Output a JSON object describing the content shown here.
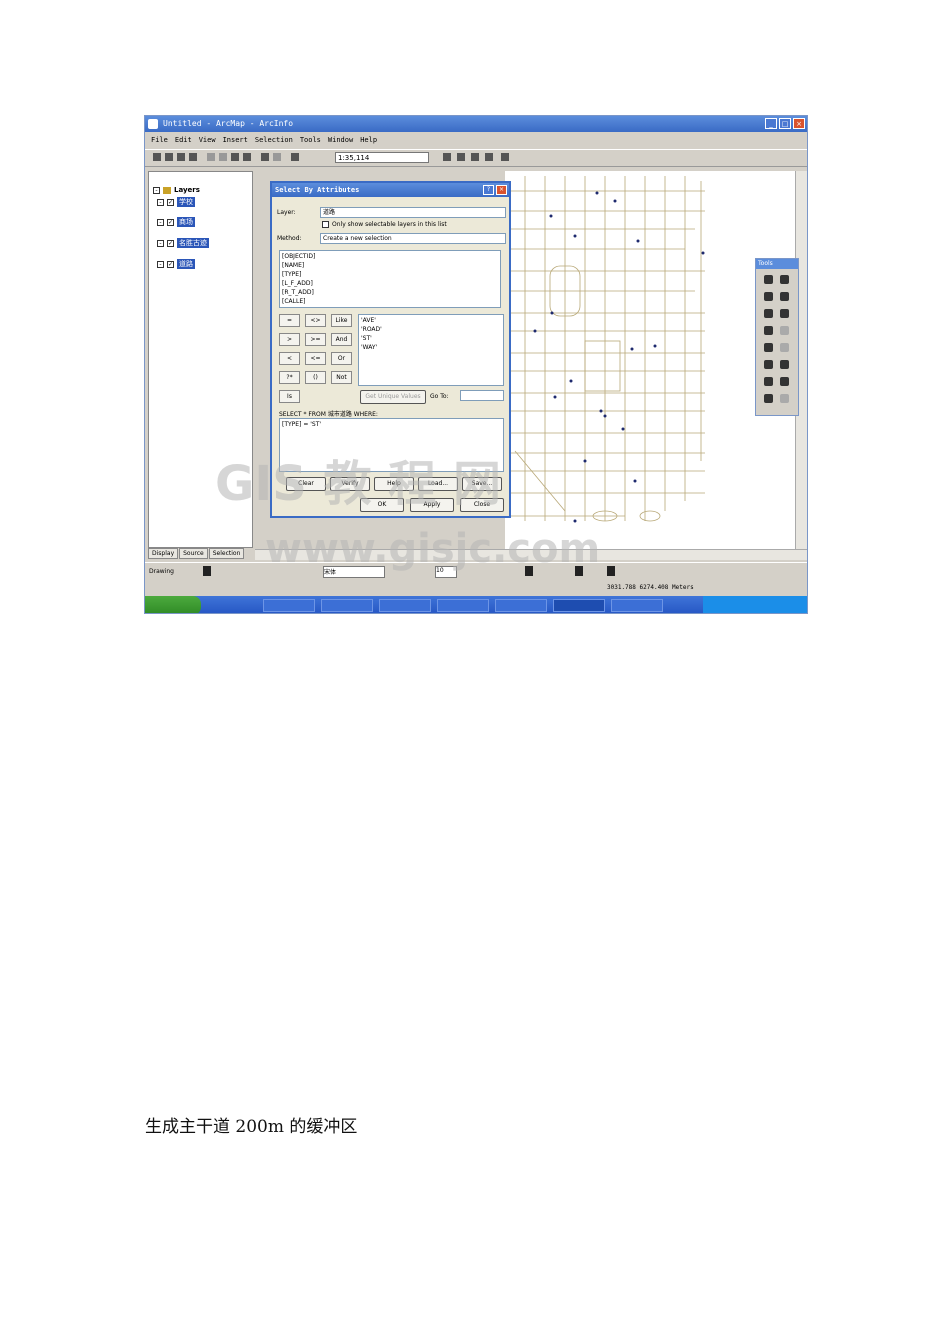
{
  "window": {
    "title": "Untitled - ArcMap - ArcInfo",
    "menu": [
      "File",
      "Edit",
      "View",
      "Insert",
      "Selection",
      "Tools",
      "Window",
      "Help"
    ],
    "scale": "1:35,114"
  },
  "toc": {
    "root": "Layers",
    "layers": [
      "学校",
      "商场",
      "名胜古迹",
      "道路"
    ],
    "tabs": [
      "Display",
      "Source",
      "Selection"
    ]
  },
  "dialog": {
    "title": "Select By Attributes",
    "layer_label": "Layer:",
    "layer_value": "道路",
    "only_selectable": "Only show selectable layers in this list",
    "method_label": "Method:",
    "method_value": "Create a new selection",
    "fields": [
      "[OBJECTID]",
      "[NAME]",
      "[TYPE]",
      "[L_F_ADD]",
      "[R_T_ADD]",
      "[CALLE]"
    ],
    "operators": [
      "=",
      "<>",
      "Like",
      ">",
      ">=",
      "And",
      "<",
      "<=",
      "Or",
      "?*",
      "()",
      "Not",
      "Is"
    ],
    "values": [
      "'AVE'",
      "'ROAD'",
      "'ST'",
      "'WAY'"
    ],
    "get_unique": "Get Unique Values",
    "goto": "Go To:",
    "query_header": "SELECT * FROM 城市道路 WHERE:",
    "query": "[TYPE] = 'ST'",
    "buttons_row1": [
      "Clear",
      "Verify",
      "Help",
      "Load...",
      "Save..."
    ],
    "buttons_row2": [
      "OK",
      "Apply",
      "Close"
    ]
  },
  "tools_panel": {
    "title": "Tools"
  },
  "status": {
    "coords": "3031.788  6274.408 Meters"
  },
  "drawing": {
    "label": "Drawing",
    "font": "宋体",
    "size": "10"
  },
  "watermark": {
    "line1": "GIS 教 程 网",
    "line2": "www.gisjc.com"
  },
  "caption": "生成主干道 200m 的缓冲区"
}
